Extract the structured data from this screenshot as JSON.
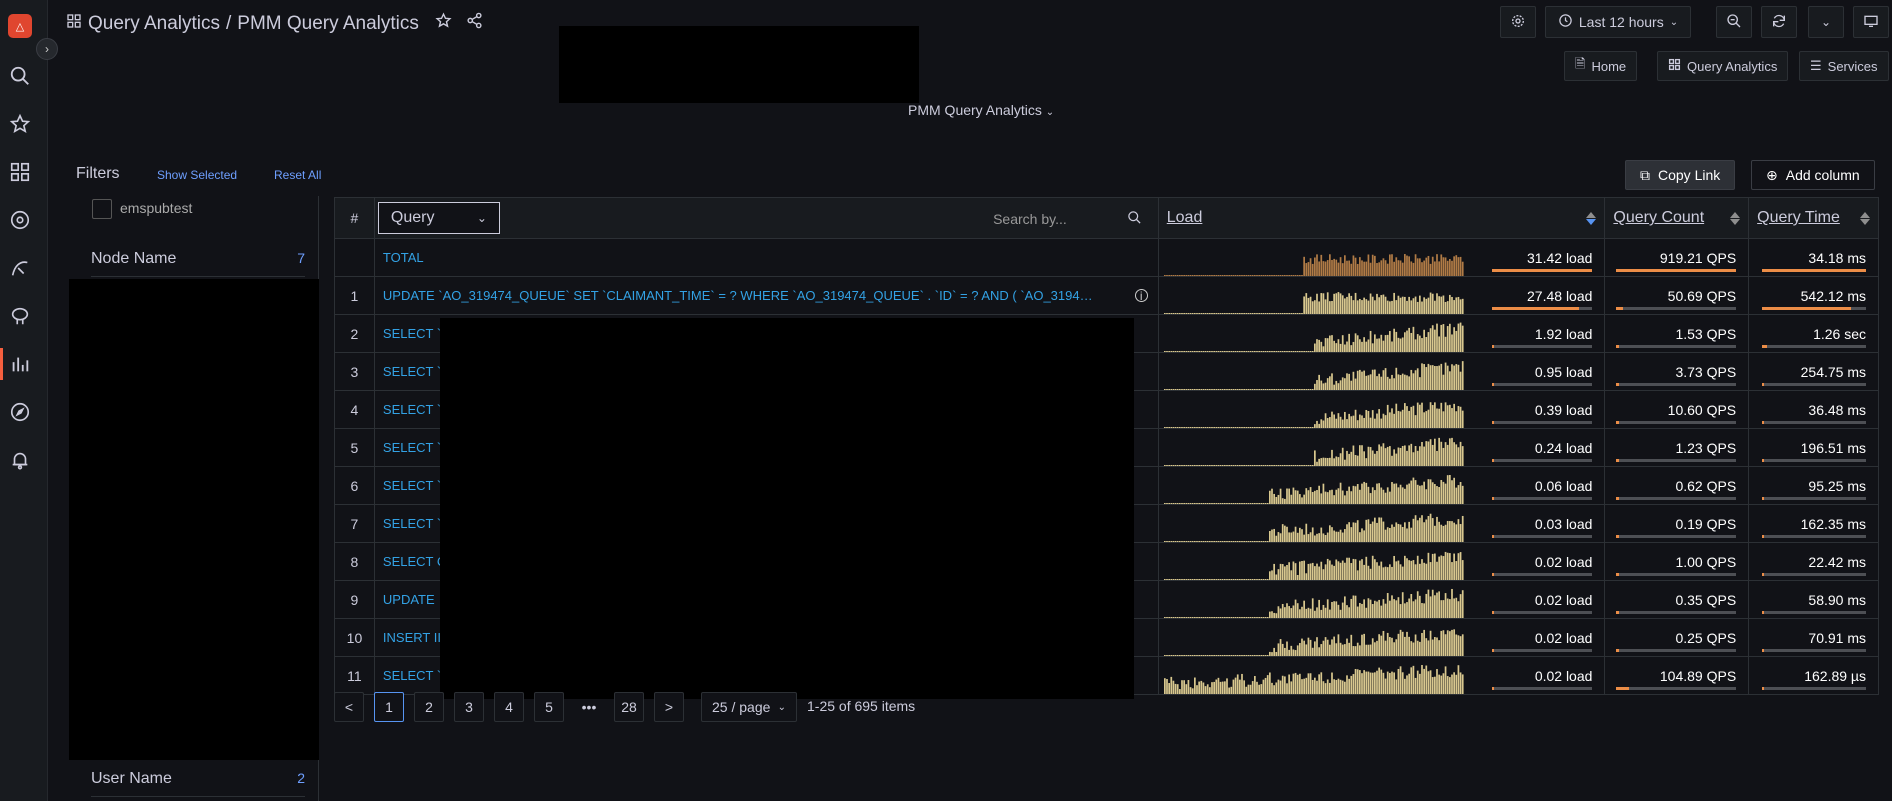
{
  "app": {
    "breadcrumb_parent": "Query Analytics",
    "breadcrumb_sep": "/",
    "breadcrumb_current": "PMM Query Analytics"
  },
  "toolbar": {
    "time_range": "Last 12 hours"
  },
  "links": {
    "home": "Home",
    "query_analytics": "Query Analytics",
    "services": "Services"
  },
  "variable": {
    "label": "PMM Query Analytics"
  },
  "filters": {
    "title": "Filters",
    "show_selected": "Show Selected",
    "reset_all": "Reset All",
    "checkbox_label": "emspubtest",
    "node_name": "Node Name",
    "node_name_count": "7",
    "user_name": "User Name",
    "user_name_count": "2"
  },
  "actions": {
    "copy_link": "Copy Link",
    "add_column": "Add column"
  },
  "table": {
    "headers": {
      "num": "#",
      "query_dim": "Query",
      "search_placeholder": "Search by...",
      "load": "Load",
      "query_count": "Query Count",
      "query_time": "Query Time"
    },
    "rows": [
      {
        "num": "",
        "query": "TOTAL",
        "load": "31.42 load",
        "qps": "919.21 QPS",
        "time": "34.18 ms",
        "load_frac": 1.0,
        "qps_frac": 1.0,
        "time_frac": 1.0
      },
      {
        "num": "1",
        "query": "UPDATE `AO_319474_QUEUE` SET `CLAIMANT_TIME` = ? WHERE `AO_319474_QUEUE` . `ID` = ? AND ( `AO_3194…",
        "load": "27.48 load",
        "qps": "50.69 QPS",
        "time": "542.12 ms",
        "load_frac": 0.87,
        "qps_frac": 0.06,
        "time_frac": 0.86
      },
      {
        "num": "2",
        "query": "SELECT `",
        "load": "1.92 load",
        "qps": "1.53 QPS",
        "time": "1.26 sec",
        "load_frac": 0.02,
        "qps_frac": 0.0,
        "time_frac": 0.05
      },
      {
        "num": "3",
        "query": "SELECT `",
        "load": "0.95 load",
        "qps": "3.73 QPS",
        "time": "254.75 ms",
        "load_frac": 0.02,
        "qps_frac": 0.0,
        "time_frac": 0.0
      },
      {
        "num": "4",
        "query": "SELECT `",
        "load": "0.39 load",
        "qps": "10.60 QPS",
        "time": "36.48 ms",
        "load_frac": 0.0,
        "qps_frac": 0.0,
        "time_frac": 0.0
      },
      {
        "num": "5",
        "query": "SELECT `",
        "load": "0.24 load",
        "qps": "1.23 QPS",
        "time": "196.51 ms",
        "load_frac": 0.0,
        "qps_frac": 0.0,
        "time_frac": 0.0
      },
      {
        "num": "6",
        "query": "SELECT `",
        "load": "0.06 load",
        "qps": "0.62 QPS",
        "time": "95.25 ms",
        "load_frac": 0.0,
        "qps_frac": 0.0,
        "time_frac": 0.0
      },
      {
        "num": "7",
        "query": "SELECT `",
        "load": "0.03 load",
        "qps": "0.19 QPS",
        "time": "162.35 ms",
        "load_frac": 0.0,
        "qps_frac": 0.0,
        "time_frac": 0.0
      },
      {
        "num": "8",
        "query": "SELECT C",
        "load": "0.02 load",
        "qps": "1.00 QPS",
        "time": "22.42 ms",
        "load_frac": 0.0,
        "qps_frac": 0.0,
        "time_frac": 0.0
      },
      {
        "num": "9",
        "query": "UPDATE",
        "load": "0.02 load",
        "qps": "0.35 QPS",
        "time": "58.90 ms",
        "load_frac": 0.0,
        "qps_frac": 0.0,
        "time_frac": 0.0
      },
      {
        "num": "10",
        "query": "INSERT II",
        "load": "0.02 load",
        "qps": "0.25 QPS",
        "time": "70.91 ms",
        "load_frac": 0.0,
        "qps_frac": 0.0,
        "time_frac": 0.0
      },
      {
        "num": "11",
        "query": "SELECT `",
        "load": "0.02 load",
        "qps": "104.89 QPS",
        "time": "162.89 µs",
        "load_frac": 0.0,
        "qps_frac": 0.11,
        "time_frac": 0.0
      }
    ]
  },
  "pagination": {
    "prev": "<",
    "next": ">",
    "pages": [
      "1",
      "2",
      "3",
      "4",
      "5",
      "•••",
      "28"
    ],
    "current": "1",
    "page_size": "25 / page",
    "summary": "1-25 of 695 items"
  },
  "colors": {
    "accent": "#5794f2",
    "query_link": "#33a2e5",
    "bar_total": "#b07b46",
    "bar_row": "#d9c88f",
    "brand": "#e0462f"
  },
  "icons": {
    "logo": "pmm-logo",
    "search": "search-icon",
    "star": "star-icon",
    "dashboards": "dashboards-icon",
    "gear": "gear-icon",
    "clock": "clock-icon",
    "zoom_out": "zoom-out-icon",
    "refresh": "refresh-icon",
    "tv": "tv-icon"
  }
}
